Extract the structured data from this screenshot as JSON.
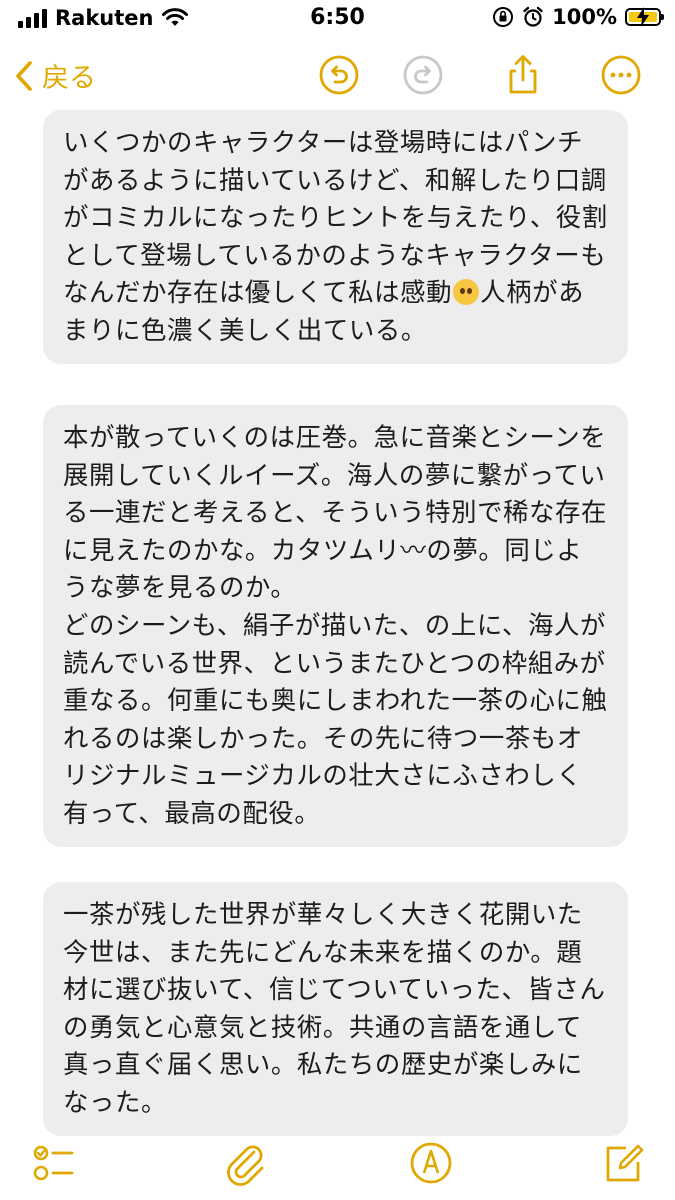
{
  "status_bar": {
    "carrier": "Rakuten",
    "time": "6:50",
    "battery_percent": "100%",
    "battery_level": 1.0,
    "icons": [
      "signal-icon",
      "wifi-icon",
      "orientation-lock-icon",
      "alarm-icon",
      "battery-charging-icon"
    ]
  },
  "nav": {
    "back_label": "戻る",
    "icons": [
      "undo-icon",
      "redo-icon",
      "share-icon",
      "more-icon"
    ]
  },
  "notes": [
    {
      "paragraphs": [
        {
          "before": "いくつかのキャラクターは登場時にはパンチがあるように描いているけど、和解したり口調がコミカルになったりヒントを与えたり、役割として登場しているかのようなキャラクターもなんだか存在は優しくて私は感動",
          "emoji": "pleading-face-emoji",
          "after": "人柄があまりに色濃く美しく出ている。"
        }
      ]
    },
    {
      "paragraphs": [
        {
          "text": "本が散っていくのは圧巻。急に音楽とシーンを展開していくルイーズ。海人の夢に繋がっている一連だと考えると、そういう特別で稀な存在に見えたのかな。カタツムリ〰の夢。同じような夢を見るのか。"
        },
        {
          "text": "どのシーンも、絹子が描いた、の上に、海人が読んでいる世界、というまたひとつの枠組みが重なる。何重にも奥にしまわれた一茶の心に触れるのは楽しかった。その先に待つ一茶もオリジナルミュージカルの壮大さにふさわしく有って、最高の配役。"
        }
      ]
    },
    {
      "paragraphs": [
        {
          "text": "一茶が残した世界が華々しく大きく花開いた今世は、また先にどんな未来を描くのか。題材に選び抜いて、信じてついていった、皆さんの勇気と心意気と技術。共通の言語を通して真っ直ぐ届く思い。私たちの歴史が楽しみになった。"
        }
      ]
    }
  ],
  "toolbar": {
    "icons": [
      "checklist-icon",
      "attachment-icon",
      "markup-icon",
      "compose-icon"
    ]
  },
  "colors": {
    "accent": "#e0a800",
    "bubble_bg": "#ededee",
    "text": "#1c1c1e",
    "disabled": "#c7c7cc"
  }
}
